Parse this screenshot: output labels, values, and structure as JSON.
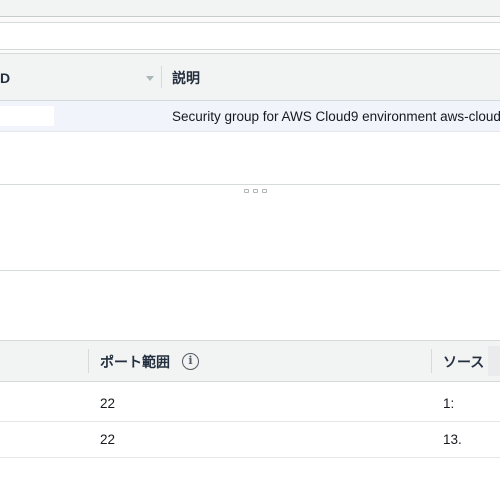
{
  "groups_table": {
    "columns": [
      {
        "label": "D",
        "sortable": true
      },
      {
        "label": "説明",
        "sortable": false
      }
    ],
    "rows": [
      {
        "id": "",
        "description": "Security group for AWS Cloud9 environment aws-cloud"
      }
    ]
  },
  "rules_table": {
    "columns": [
      {
        "label": ""
      },
      {
        "label": "ポート範囲",
        "info_icon": "i"
      },
      {
        "label": "ソース"
      }
    ],
    "rows": [
      {
        "port_range": "22",
        "source": "1:"
      },
      {
        "port_range": "22",
        "source": "13."
      }
    ]
  }
}
